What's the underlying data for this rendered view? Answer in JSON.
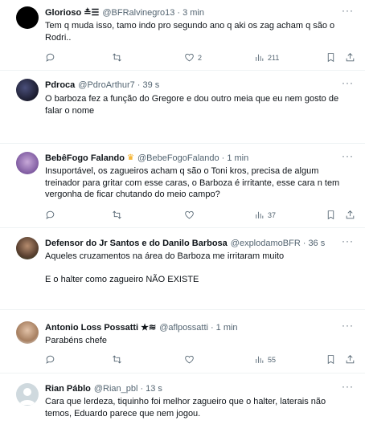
{
  "tweets": [
    {
      "name": "Glorioso ≛☰",
      "handle": "@BFRalvinegro13",
      "sep": "·",
      "time": "3 min",
      "text": "Tem q muda isso, tamo indo pro segundo ano q aki os zag acham q são o Rodri..",
      "replies": "",
      "retweets": "",
      "likes": "2",
      "views": "211"
    },
    {
      "name": "Pdroca",
      "handle": "@PdroArthur7",
      "sep": "·",
      "time": "39 s",
      "text": "O barboza fez a função do Gregore e dou outro meia que eu nem gosto de falar o nome",
      "replies": "",
      "retweets": "",
      "likes": "",
      "views": ""
    },
    {
      "name": "BebêFogo Falando",
      "handle": "@BebeFogoFalando",
      "sep": "·",
      "time": "1 min",
      "text": "Insuportável, os zagueiros acham q são o Toni kros, precisa de algum treinador para gritar com esse caras, o Barboza é irritante, esse cara n tem vergonha de ficar chutando do meio campo?",
      "replies": "",
      "retweets": "",
      "likes": "",
      "views": "37"
    },
    {
      "name": "Defensor do Jr Santos e do Danilo Barbosa",
      "handle": "@explodamoBFR",
      "sep": "·",
      "time": "36 s",
      "text": "Aqueles cruzamentos na área do Barboza me irritaram muito\n\nE o halter como zagueiro NÃO EXISTE",
      "replies": "",
      "retweets": "",
      "likes": "",
      "views": ""
    },
    {
      "name": "Antonio Loss Possatti ★≋",
      "handle": "@aflpossatti",
      "sep": "·",
      "time": "1 min",
      "text": "Parabéns chefe",
      "replies": "",
      "retweets": "",
      "likes": "",
      "views": "55"
    },
    {
      "name": "Rian Páblo",
      "handle": "@Rian_pbl",
      "sep": "·",
      "time": "13 s",
      "text": "Cara que lerdeza, tiquinho foi melhor zagueiro que o halter, laterais não temos, Eduardo parece que nem jogou.",
      "replies": "",
      "retweets": "",
      "likes": "",
      "views": ""
    }
  ],
  "colors": {
    "text": "#0f1419",
    "muted": "#536471",
    "divider": "#eff3f4",
    "crown": "#f4a300"
  },
  "icons": [
    "more-icon",
    "reply-icon",
    "retweet-icon",
    "like-icon",
    "views-icon",
    "bookmark-icon",
    "share-icon",
    "crown-icon"
  ]
}
